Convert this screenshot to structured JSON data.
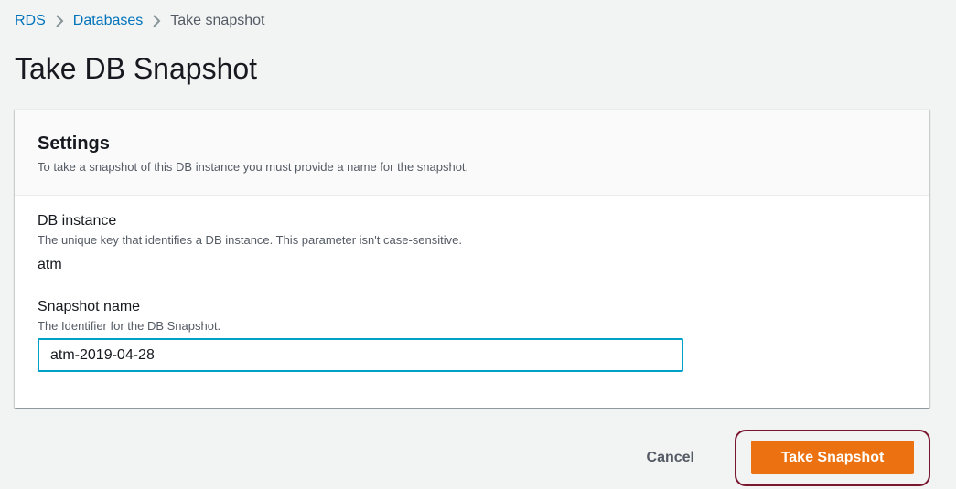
{
  "breadcrumb": {
    "items": [
      {
        "label": "RDS"
      },
      {
        "label": "Databases"
      },
      {
        "label": "Take snapshot"
      }
    ]
  },
  "page": {
    "title": "Take DB Snapshot"
  },
  "settings": {
    "title": "Settings",
    "description": "To take a snapshot of this DB instance you must provide a name for the snapshot.",
    "db_instance": {
      "label": "DB instance",
      "description": "The unique key that identifies a DB instance. This parameter isn't case-sensitive.",
      "value": "atm"
    },
    "snapshot_name": {
      "label": "Snapshot name",
      "description": "The Identifier for the DB Snapshot.",
      "value": "atm-2019-04-28"
    }
  },
  "actions": {
    "cancel_label": "Cancel",
    "submit_label": "Take Snapshot"
  },
  "colors": {
    "link": "#0073bb",
    "primary_button": "#ec7211",
    "focus_border": "#00a1c9",
    "highlight_ring": "#7a1730"
  }
}
